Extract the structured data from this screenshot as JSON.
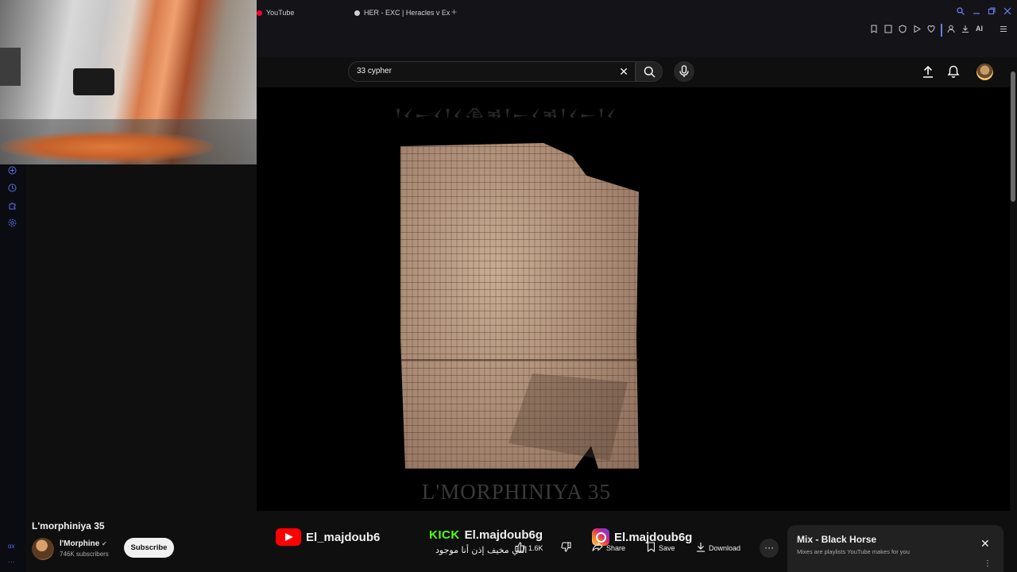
{
  "browser": {
    "tabs": [
      {
        "label": "YouTube",
        "dot_color": "#ff0033"
      },
      {
        "label": "HER - EXC | Heracles v Ex",
        "dot_color": "#cfcfd6"
      }
    ],
    "new_tab": "+",
    "ai_label": "AI"
  },
  "search": {
    "query": "33 cypher",
    "clear": "✕"
  },
  "video": {
    "cuneiform_title": "𒁹𒌋𒀸𒌋𒁹𒌋𒆠𒂊𒁹𒀸𒌋𒂊𒁹𒌋𒀸𒁹𒌋",
    "overlay_title": "L'MORPHINIYA 35"
  },
  "details": {
    "title": "L'morphiniya 35",
    "channel": "l'Morphine",
    "verified": "✔",
    "subscribers": "746K subscribers",
    "subscribe_label": "Subscribe"
  },
  "social": {
    "youtube_handle": "El_majdoub6",
    "kick_label": "KICK",
    "kick_handle": "El.majdoub6g",
    "instagram_handle": "El.majdoub6g",
    "arabic_text": "اللي مخيف إذن أنا موجود"
  },
  "actions": {
    "likes": "1.6K",
    "share": "Share",
    "save": "Save",
    "download": "Download",
    "more": "···"
  },
  "mix": {
    "title": "Mix - Black Horse",
    "subtitle": "Mixes are playlists YouTube makes for you",
    "close": "✕",
    "menu": "⋮"
  },
  "sidebar": {
    "bottom_label": "αx",
    "bottom_more": "···"
  },
  "colors": {
    "accent": "#6b7cf0",
    "youtube_red": "#ff0000",
    "kick_green": "#53fc18"
  }
}
